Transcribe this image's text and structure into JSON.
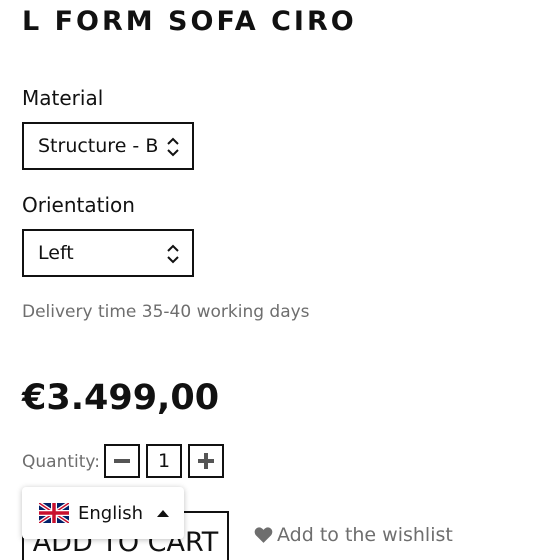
{
  "product": {
    "title": "L FORM SOFA CIRO",
    "delivery": "Delivery time 35-40 working days",
    "price": "€3.499,00"
  },
  "options": {
    "material_label": "Material",
    "material_value": "Structure - Be",
    "orientation_label": "Orientation",
    "orientation_value": "Left"
  },
  "quantity": {
    "label": "Quantity:",
    "value": "1"
  },
  "actions": {
    "add_to_cart": "ADD TO CART",
    "wishlist": "Add to the wishlist"
  },
  "language": {
    "current": "English",
    "flag": "uk-flag-icon"
  },
  "colors": {
    "text": "#111111",
    "muted": "#6e6e6e",
    "border": "#111111",
    "background": "#ffffff"
  },
  "icons": {
    "select_chevron": "chevron-up-down-icon",
    "minus": "minus-icon",
    "plus": "plus-icon",
    "heart": "heart-icon",
    "caret": "caret-up-icon"
  }
}
